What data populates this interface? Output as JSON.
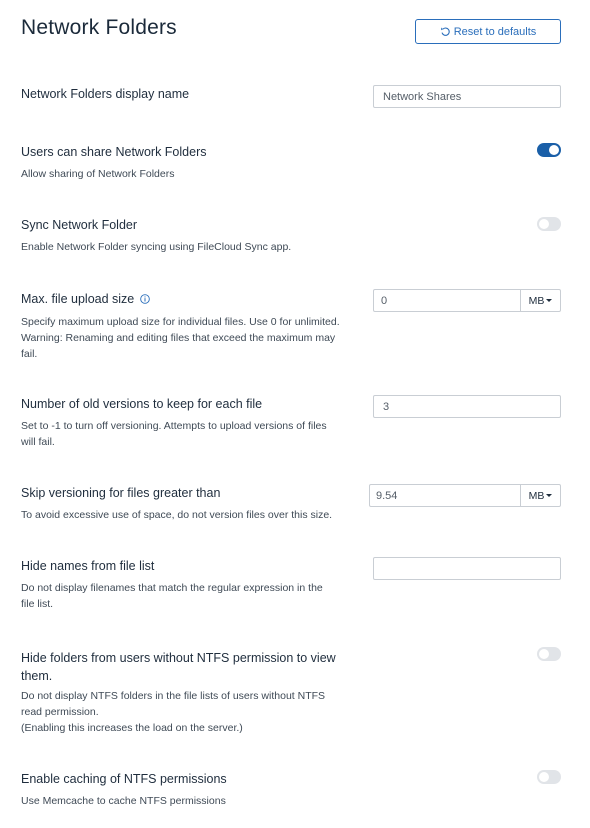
{
  "header": {
    "title": "Network Folders",
    "reset_label": "Reset to defaults"
  },
  "settings": {
    "display_name": {
      "label": "Network Folders display name",
      "value": "Network Shares"
    },
    "users_can_share": {
      "label": "Users can share Network Folders",
      "description": "Allow sharing of Network Folders",
      "enabled": true
    },
    "sync_network_folder": {
      "label": "Sync Network Folder",
      "description": "Enable Network Folder syncing using FileCloud Sync app.",
      "enabled": false
    },
    "max_upload": {
      "label": "Max. file upload size",
      "description_1": "Specify maximum upload size for individual files. Use 0 for unlimited.",
      "description_2": "Warning: Renaming and editing files that exceed the maximum may",
      "description_3": "fail.",
      "value": "0",
      "unit": "MB"
    },
    "old_versions": {
      "label": "Number of old versions to keep for each file",
      "description_1": "Set to -1 to turn off versioning. Attempts to upload versions of files",
      "description_2": "will fail.",
      "value": "3"
    },
    "skip_versioning": {
      "label": "Skip versioning for files greater than",
      "description": "To avoid excessive use of space, do not version files over this size.",
      "value": "9.54",
      "unit": "MB"
    },
    "hide_names": {
      "label": "Hide names from file list",
      "description_1": "Do not display filenames that match the regular expression in the",
      "description_2": "file list.",
      "value": ""
    },
    "hide_folders_ntfs": {
      "label_1": "Hide folders from users without NTFS permission to view",
      "label_2": "them.",
      "description_1": "Do not display NTFS folders in the file lists of users without NTFS",
      "description_2": "read permission.",
      "description_3": "(Enabling this increases the load on the server.)",
      "enabled": false
    },
    "ntfs_caching": {
      "label": "Enable caching of NTFS permissions",
      "description": "Use Memcache to cache NTFS permissions",
      "enabled": false
    }
  },
  "colors": {
    "accent": "#2a6ebb",
    "toggle_on": "#1a5fa8",
    "toggle_off": "#e1e4e8"
  }
}
